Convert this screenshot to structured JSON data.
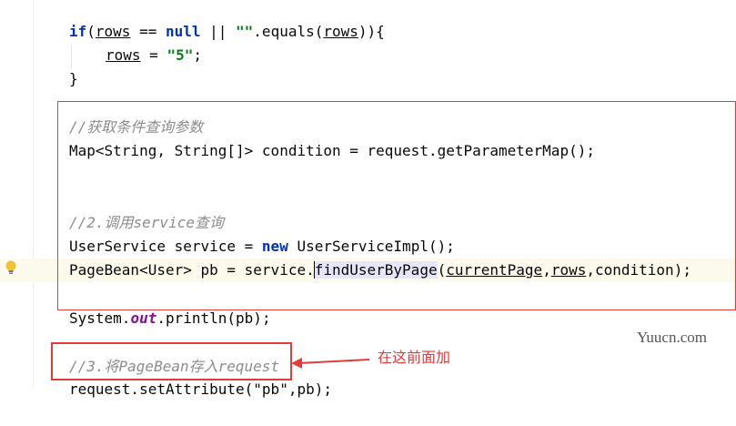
{
  "code": {
    "line1": {
      "kw_if": "if",
      "p1": "(",
      "rows1": "rows",
      "p2": " == ",
      "kw_null": "null",
      "p3": " || ",
      "str_empty": "\"\"",
      "p4": ".equals(",
      "rows2": "rows",
      "p5": ")){"
    },
    "line2": {
      "rows": "rows",
      "p1": " = ",
      "str5": "\"5\"",
      "p2": ";"
    },
    "line3": {
      "text": "}"
    },
    "line4": {
      "comment": "//获取条件查询参数"
    },
    "line5": {
      "text": "Map<String, String[]> condition = request.getParameterMap();"
    },
    "line6": {
      "comment": "//2.调用service查询"
    },
    "line7": {
      "p1": "UserService service = ",
      "kw_new": "new",
      "p2": " UserServiceImpl();"
    },
    "line8": {
      "p1": "PageBean<User> pb = service.",
      "method": "findUserByPage",
      "p2": "(",
      "arg1": "currentPage",
      "p3": ",",
      "arg2": "rows",
      "p4": ",condition);"
    },
    "line9": {
      "p1": "System.",
      "field": "out",
      "p2": ".println(pb);"
    },
    "line10": {
      "comment": "//3.将PageBean存入request"
    },
    "line11": {
      "text": "request.setAttribute(\"pb\",pb);"
    }
  },
  "annotation": {
    "text": "在这前面加"
  },
  "watermark": {
    "text": "Yuucn.com"
  },
  "colors": {
    "annotation_red": "#e03c3c",
    "keyword": "#0033b3",
    "string": "#067d17",
    "comment": "#8c8c8c"
  },
  "icons": {
    "gutter": "lightbulb-icon"
  }
}
